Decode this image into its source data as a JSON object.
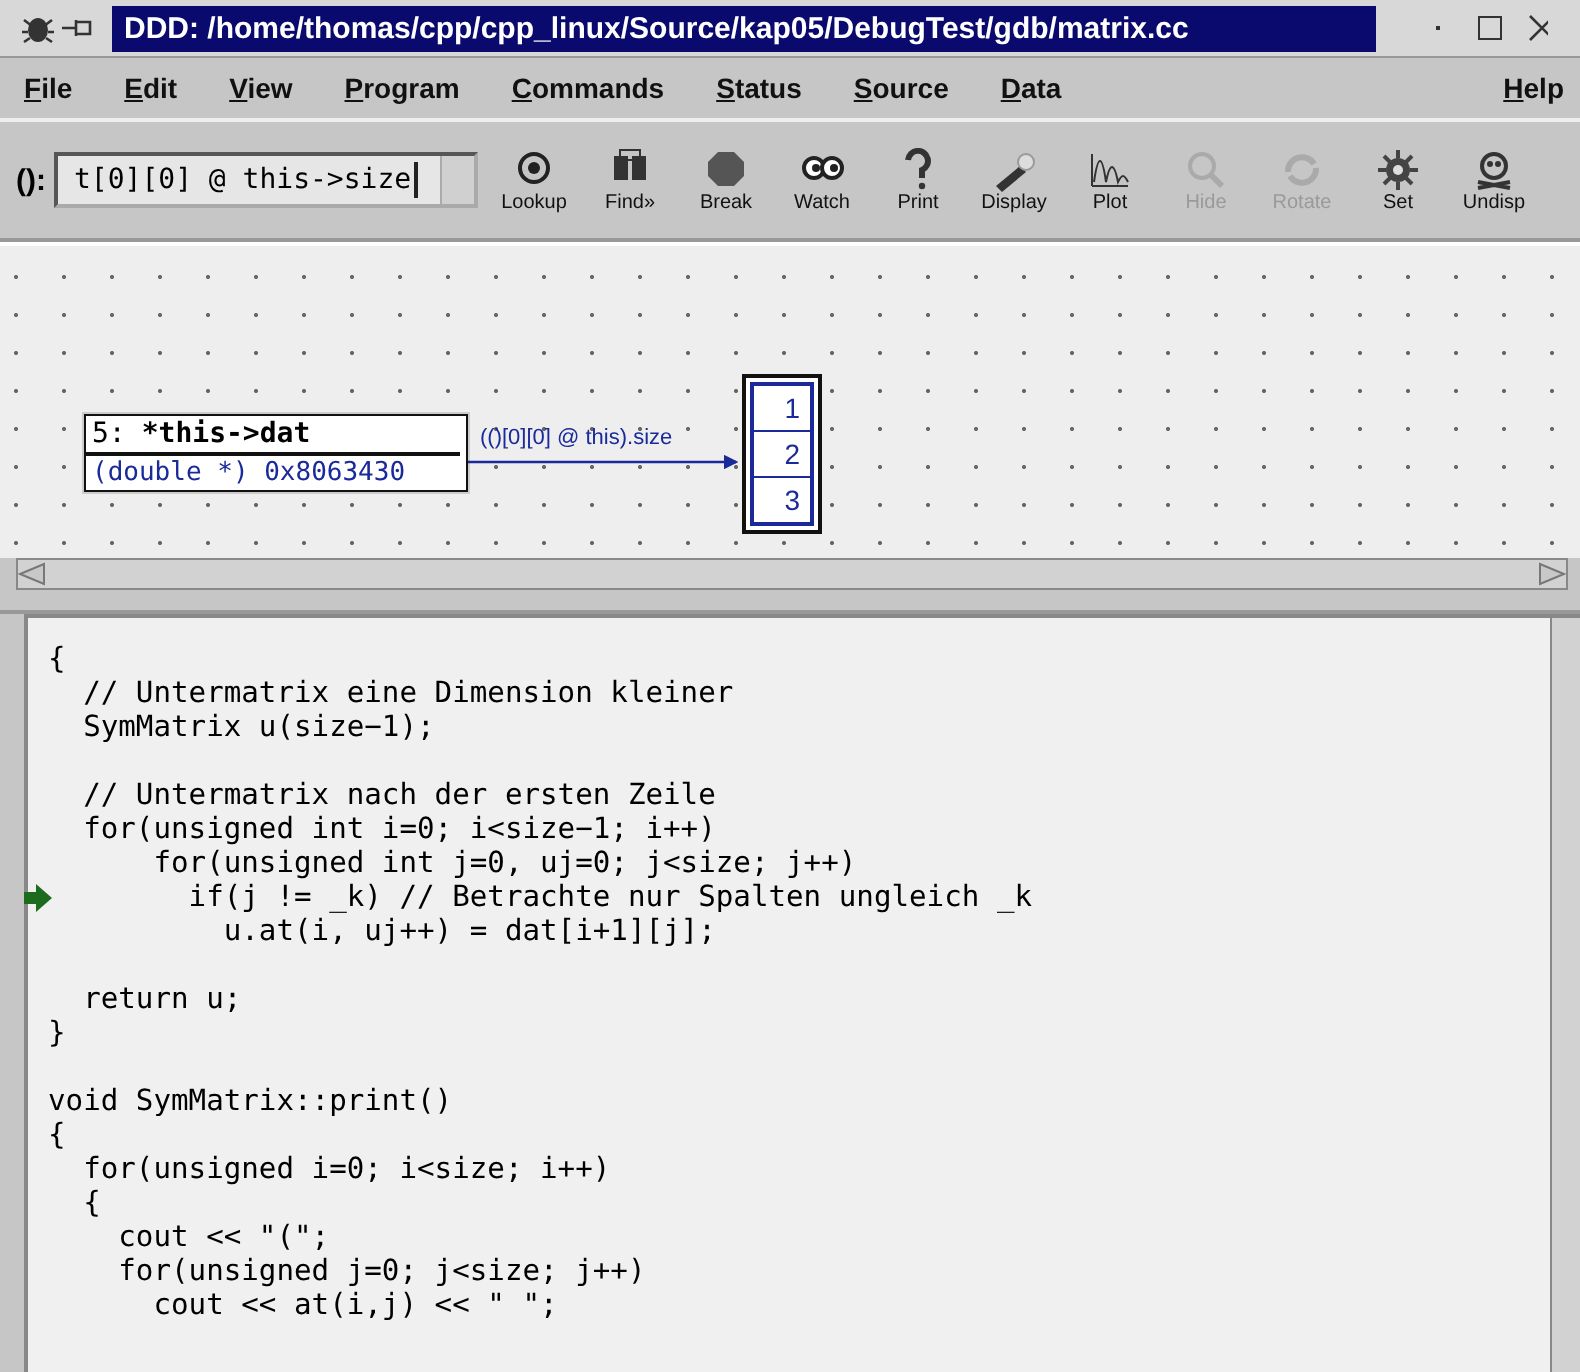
{
  "window": {
    "title": "DDD: /home/thomas/cpp/cpp_linux/Source/kap05/DebugTest/gdb/matrix.cc"
  },
  "menu": {
    "items": [
      "File",
      "Edit",
      "View",
      "Program",
      "Commands",
      "Status",
      "Source",
      "Data"
    ],
    "help": "Help"
  },
  "toolbar": {
    "label": "():",
    "argument": "t[0][0] @ this->size",
    "buttons": [
      {
        "label": "Lookup",
        "kind": "lookup",
        "disabled": false
      },
      {
        "label": "Find»",
        "kind": "find",
        "disabled": false
      },
      {
        "label": "Break",
        "kind": "break",
        "disabled": false
      },
      {
        "label": "Watch",
        "kind": "watch",
        "disabled": false
      },
      {
        "label": "Print",
        "kind": "print",
        "disabled": false
      },
      {
        "label": "Display",
        "kind": "display",
        "disabled": false
      },
      {
        "label": "Plot",
        "kind": "plot",
        "disabled": false
      },
      {
        "label": "Hide",
        "kind": "hide",
        "disabled": true
      },
      {
        "label": "Rotate",
        "kind": "rotate",
        "disabled": true
      },
      {
        "label": "Set",
        "kind": "set",
        "disabled": false
      },
      {
        "label": "Undisp",
        "kind": "undisp",
        "disabled": false
      }
    ]
  },
  "data_display": {
    "node": {
      "number": "5:",
      "expression": "*this->dat",
      "value": "(double *) 0x8063430"
    },
    "edge_label": "(()[0][0] @ this).size",
    "array": [
      "1",
      "2",
      "3"
    ]
  },
  "source": {
    "lines": [
      {
        "kind": "code",
        "text": "{",
        "current": false
      },
      {
        "kind": "code",
        "text": "  // Untermatrix eine Dimension kleiner",
        "current": false
      },
      {
        "kind": "code",
        "text": "  SymMatrix u(size−1);",
        "current": false
      },
      {
        "kind": "blank"
      },
      {
        "kind": "code",
        "text": "  // Untermatrix nach der ersten Zeile",
        "current": false
      },
      {
        "kind": "code",
        "text": "  for(unsigned int i=0; i<size−1; i++)",
        "current": false
      },
      {
        "kind": "code",
        "text": "      for(unsigned int j=0, uj=0; j<size; j++)",
        "current": false
      },
      {
        "kind": "code",
        "text": "        if(j != _k) // Betrachte nur Spalten ungleich _k",
        "current": true
      },
      {
        "kind": "code",
        "text": "          u.at(i, uj++) = dat[i+1][j];",
        "current": false
      },
      {
        "kind": "blank"
      },
      {
        "kind": "code",
        "text": "  return u;",
        "current": false
      },
      {
        "kind": "code",
        "text": "}",
        "current": false
      },
      {
        "kind": "blank"
      },
      {
        "kind": "code",
        "text": "void SymMatrix::print()",
        "current": false
      },
      {
        "kind": "code",
        "text": "{",
        "current": false
      },
      {
        "kind": "code",
        "text": "  for(unsigned i=0; i<size; i++)",
        "current": false
      },
      {
        "kind": "code",
        "text": "  {",
        "current": false
      },
      {
        "kind": "code",
        "text": "    cout << \"(\";",
        "current": false
      },
      {
        "kind": "code",
        "text": "    for(unsigned j=0; j<size; j++)",
        "current": false
      },
      {
        "kind": "code",
        "text": "      cout << at(i,j) << \" \";",
        "current": false
      }
    ]
  }
}
